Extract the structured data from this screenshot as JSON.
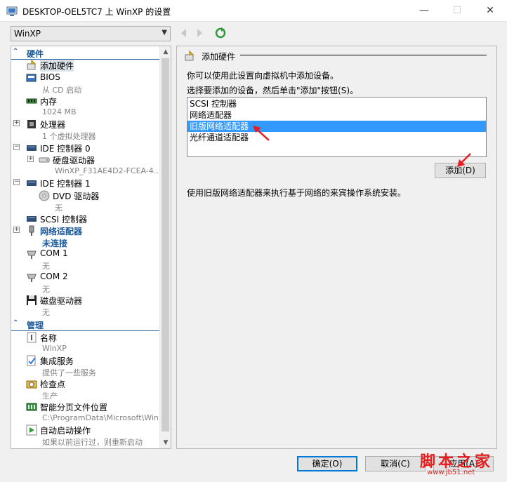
{
  "window": {
    "title": "DESKTOP-OEL5TC7 上 WinXP 的设置",
    "minimize": "—",
    "maximize": "☐",
    "close": "✕"
  },
  "toolbar": {
    "vm_selected": "WinXP"
  },
  "sidebar": {
    "hardware_header": "硬件",
    "management_header": "管理",
    "hardware_items": [
      {
        "label": "添加硬件"
      },
      {
        "label": "BIOS",
        "sub": "从 CD 启动"
      },
      {
        "label": "内存",
        "sub": "1024 MB"
      },
      {
        "label": "处理器",
        "sub": "1 个虚拟处理器"
      },
      {
        "label": "IDE 控制器 0"
      },
      {
        "label": "硬盘驱动器",
        "sub": "WinXP_F31AE4D2-FCEA-4..."
      },
      {
        "label": "IDE 控制器 1"
      },
      {
        "label": "DVD 驱动器",
        "sub": "无"
      },
      {
        "label": "SCSI 控制器"
      },
      {
        "label": "网络适配器",
        "sub": "未连接"
      },
      {
        "label": "COM 1",
        "sub": "无"
      },
      {
        "label": "COM 2",
        "sub": "无"
      },
      {
        "label": "磁盘驱动器",
        "sub": "无"
      }
    ],
    "management_items": [
      {
        "label": "名称",
        "sub": "WinXP"
      },
      {
        "label": "集成服务",
        "sub": "提供了一些服务"
      },
      {
        "label": "检查点",
        "sub": "生产"
      },
      {
        "label": "智能分页文件位置",
        "sub": "C:\\ProgramData\\Microsoft\\Win..."
      },
      {
        "label": "自动启动操作",
        "sub": "如果以前运行过，则重新启动"
      }
    ]
  },
  "main": {
    "header": "添加硬件",
    "desc1": "你可以使用此设置向虚拟机中添加设备。",
    "desc2": "选择要添加的设备，然后单击\"添加\"按钮(S)。",
    "devices": [
      "SCSI 控制器",
      "网络适配器",
      "旧版网络适配器",
      "光纤通道适配器"
    ],
    "selected_index": 2,
    "add_button": "添加(D)",
    "info": "使用旧版网络适配器来执行基于网络的来宾操作系统安装。"
  },
  "footer": {
    "ok": "确定(O)",
    "cancel": "取消(C)",
    "apply": "应用(A)"
  },
  "watermark": {
    "text": "脚本之家",
    "url": "www.jb51.net"
  },
  "colors": {
    "accent": "#1c5a9c",
    "selection": "#3399ff",
    "annotation_arrow": "#e51f1f"
  }
}
